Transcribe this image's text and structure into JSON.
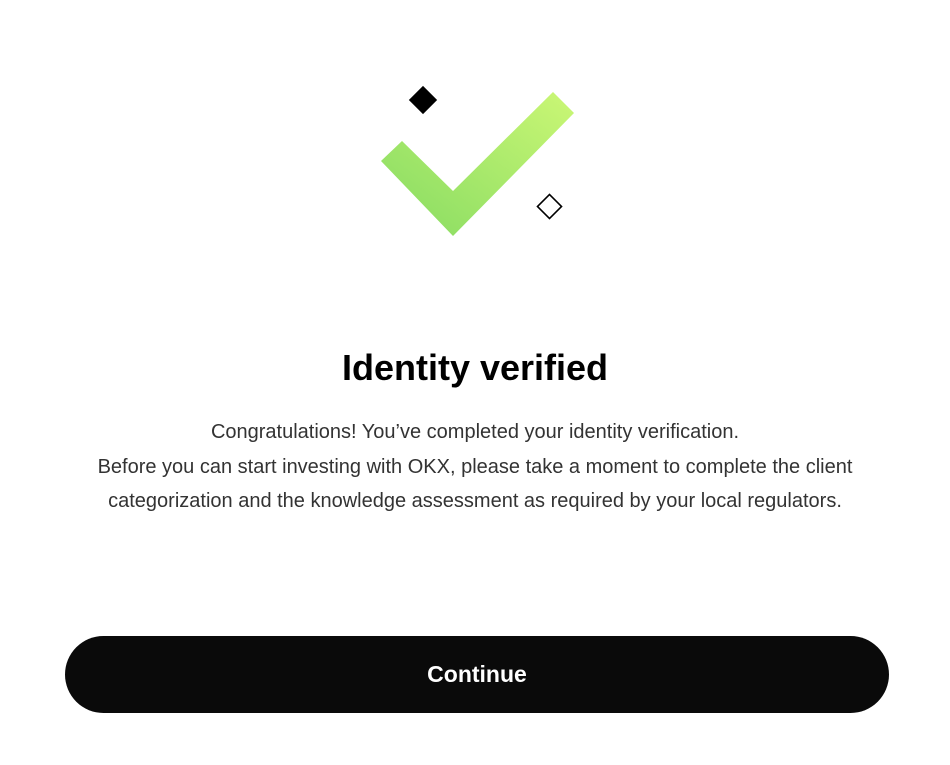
{
  "verification": {
    "title": "Identity verified",
    "message_line1": "Congratulations! You’ve completed your identity verification.",
    "message_line2": "Before you can start investing with OKX, please take a moment to complete the client categorization and the knowledge assessment as required by your local regulators."
  },
  "actions": {
    "continue_label": "Continue"
  },
  "icons": {
    "success": "checkmark-icon",
    "decor_filled": "diamond-filled-icon",
    "decor_outline": "diamond-outline-icon"
  },
  "colors": {
    "check_start": "#8ede64",
    "check_end": "#c8f774",
    "button_bg": "#0a0a0a",
    "button_text": "#ffffff"
  }
}
